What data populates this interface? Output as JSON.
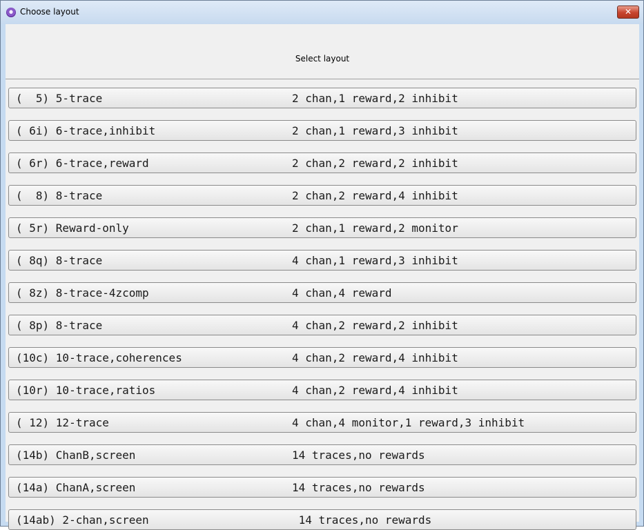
{
  "window": {
    "title": "Choose layout",
    "close_label": "✕"
  },
  "header": {
    "text": "Select layout"
  },
  "layouts": [
    {
      "label": "(  5) 5-trace",
      "desc": "2 chan,1 reward,2 inhibit"
    },
    {
      "label": "( 6i) 6-trace,inhibit",
      "desc": "2 chan,1 reward,3 inhibit"
    },
    {
      "label": "( 6r) 6-trace,reward",
      "desc": "2 chan,2 reward,2 inhibit"
    },
    {
      "label": "(  8) 8-trace",
      "desc": "2 chan,2 reward,4 inhibit"
    },
    {
      "label": "( 5r) Reward-only",
      "desc": "2 chan,1 reward,2 monitor"
    },
    {
      "label": "( 8q) 8-trace",
      "desc": "4 chan,1 reward,3 inhibit"
    },
    {
      "label": "( 8z) 8-trace-4zcomp",
      "desc": "4 chan,4 reward"
    },
    {
      "label": "( 8p) 8-trace",
      "desc": "4 chan,2 reward,2 inhibit"
    },
    {
      "label": "(10c) 10-trace,coherences",
      "desc": "4 chan,2 reward,4 inhibit"
    },
    {
      "label": "(10r) 10-trace,ratios",
      "desc": "4 chan,2 reward,4 inhibit"
    },
    {
      "label": "( 12) 12-trace",
      "desc": "4 chan,4 monitor,1 reward,3 inhibit"
    },
    {
      "label": "(14b) ChanB,screen",
      "desc": "14 traces,no rewards"
    },
    {
      "label": "(14a) ChanA,screen",
      "desc": "14 traces,no rewards"
    },
    {
      "label": "(14ab) 2-chan,screen",
      "desc": " 14 traces,no rewards"
    }
  ]
}
